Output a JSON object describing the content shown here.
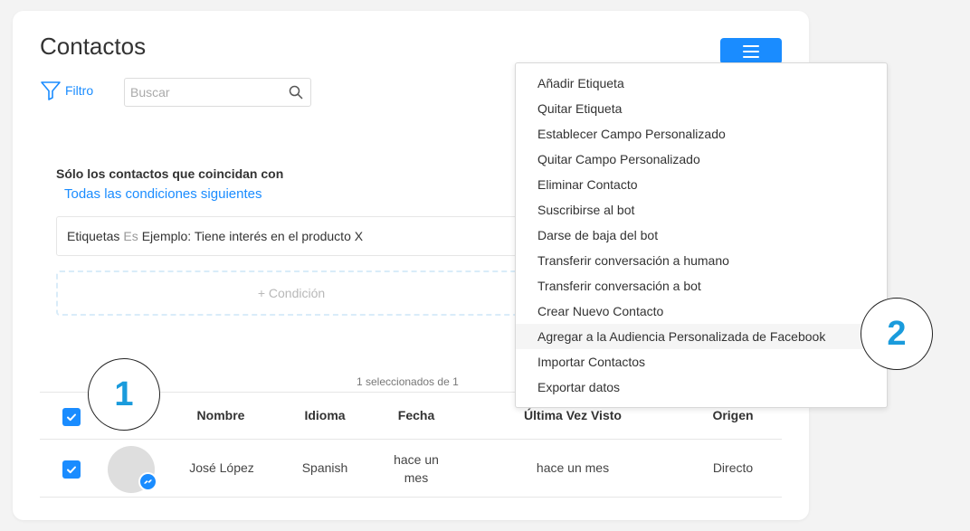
{
  "page": {
    "title": "Contactos"
  },
  "toolbar": {
    "filter_label": "Filtro",
    "search_placeholder": "Buscar",
    "search_value": ""
  },
  "conditions": {
    "heading": "Sólo los contactos que coincidan con",
    "match_mode": "Todas las condiciones siguientes",
    "rule": {
      "field": "Etiquetas",
      "operator": "Es",
      "value": "Ejemplo: Tiene interés en el producto X"
    },
    "add_label": "+ Condición"
  },
  "table": {
    "selected_count": "1 seleccionados de 1",
    "header_checkbox_checked": true,
    "columns": [
      "Nombre",
      "Idioma",
      "Fecha",
      "Última Vez Visto",
      "Origen"
    ],
    "rows": [
      {
        "checked": true,
        "name": "José López",
        "language": "Spanish",
        "date_line1": "hace un",
        "date_line2": "mes",
        "last_seen": "hace un mes",
        "origin": "Directo",
        "channel_icon": "messenger-icon"
      }
    ]
  },
  "menu": {
    "items": [
      "Añadir Etiqueta",
      "Quitar Etiqueta",
      "Establecer Campo Personalizado",
      "Quitar Campo Personalizado",
      "Eliminar Contacto",
      "Suscribirse al bot",
      "Darse de baja del bot",
      "Transferir conversación a humano",
      "Transferir conversación a bot",
      "Crear Nuevo Contacto",
      "Agregar a la Audiencia Personalizada de Facebook",
      "Importar Contactos",
      "Exportar datos"
    ],
    "highlighted_index": 10
  },
  "callouts": {
    "first": "1",
    "second": "2"
  },
  "colors": {
    "accent": "#1a8cff",
    "callout_text": "#1a9bdc"
  }
}
